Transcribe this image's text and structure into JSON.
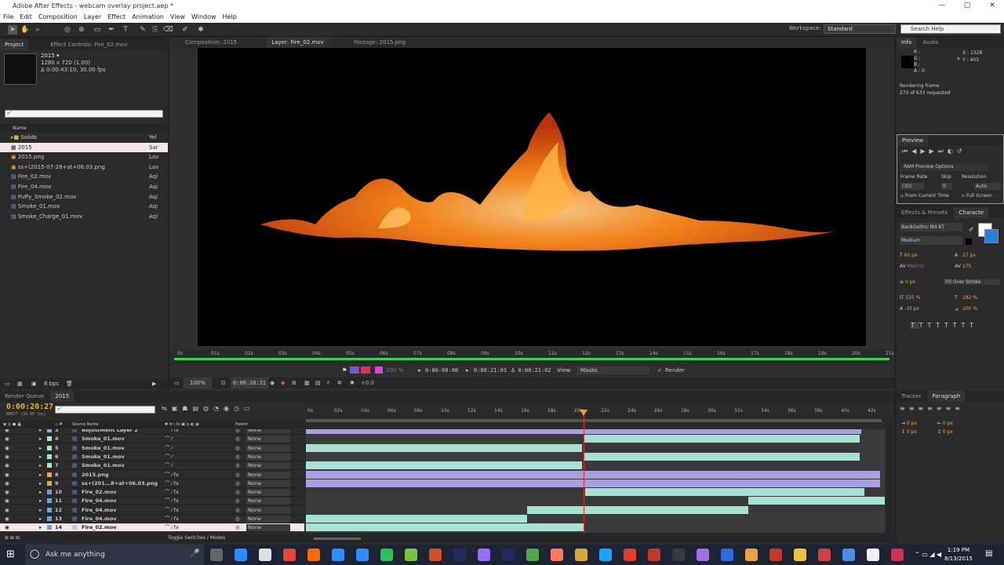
{
  "window": {
    "title": "Adobe After Effects - webcam overlay project.aep *"
  },
  "menu": [
    "File",
    "Edit",
    "Composition",
    "Layer",
    "Effect",
    "Animation",
    "View",
    "Window",
    "Help"
  ],
  "toolbar": {
    "workspace_label": "Workspace:",
    "workspace_value": "Standard",
    "search_placeholder": "Search Help"
  },
  "project": {
    "tabs": [
      "Project",
      "Effect Controls: Fire_02.mov"
    ],
    "selected_name": "2015 ▾",
    "selected_info1": "1280 x 720 (1.00)",
    "selected_info2": "Δ 0:00:43:10, 30.00 fps",
    "search_placeholder": "⌕ᐟ",
    "col_name": "Name",
    "items": [
      {
        "name": "Solids",
        "type": "Yel"
      },
      {
        "name": "2015",
        "type": "Sar"
      },
      {
        "name": "2015.png",
        "type": "Lav"
      },
      {
        "name": "ss+(2015-07-28+at+06.03.png",
        "type": "Lav"
      },
      {
        "name": "Fire_02.mov",
        "type": "Aqi"
      },
      {
        "name": "Fire_04.mov",
        "type": "Aqi"
      },
      {
        "name": "Puffy_Smoke_02.mov",
        "type": "Aqi"
      },
      {
        "name": "Smoke_01.mov",
        "type": "Aqi"
      },
      {
        "name": "Smoke_Charge_01.mov",
        "type": "Aqi"
      }
    ],
    "bpc": "8 bpc"
  },
  "viewer": {
    "tabs": [
      "Composition: 2015",
      "Layer: Fire_02.mov",
      "Footage: 2015.png"
    ],
    "ruler_labels": [
      "0s",
      "01s",
      "02s",
      "03s",
      "04s",
      "05s",
      "06s",
      "07s",
      "08s",
      "09s",
      "10s",
      "11s",
      "12s",
      "13s",
      "14s",
      "15s",
      "16s",
      "17s",
      "18s",
      "19s",
      "20s",
      "21s"
    ],
    "in_time": "0:00:00:00",
    "out_time": "0:00:21:01",
    "duration": "Δ 0:00:21:02",
    "view_label": "View:",
    "view_value": "Masks",
    "render_label": "Render",
    "zoom": "100%",
    "timecode": "0:00:20:21",
    "exposure": "+0.0",
    "percent": "100 %"
  },
  "info": {
    "tabs": [
      "Info",
      "Audio"
    ],
    "r": "R :",
    "g": "G :",
    "b": "B :",
    "a": "A : 0",
    "x": "X : 1328",
    "y": "Y : 403",
    "status1": "Rendering frame",
    "status2": "270 of 633 requested"
  },
  "preview": {
    "tab": "Preview",
    "ram_options": "RAM Preview Options",
    "frame_rate_label": "Frame Rate",
    "skip_label": "Skip",
    "resolution_label": "Resolution",
    "frame_rate": "(30)",
    "skip": "0",
    "resolution": "Auto",
    "from_current": "From Current Time",
    "full_screen": "Full Screen"
  },
  "character": {
    "tabs": [
      "Effects & Presets",
      "Characte"
    ],
    "font": "BankGothic Md BT",
    "style": "Medium",
    "size": "60 px",
    "leading": "27 px",
    "kerning": "Metrics",
    "tracking": "175",
    "stroke": "0 px",
    "stroke_mode": "Fill Over Stroke",
    "vscale": "535 %",
    "hscale": "182 %",
    "baseline": "-33 px",
    "tsume": "100 %"
  },
  "timeline": {
    "tabs": [
      "Render Queue",
      "2015"
    ],
    "timecode": "0:00:20:27",
    "timecode_sub": "00627 (30.00 fps)",
    "search_placeholder": "⌕ᐟ",
    "col_source": "Source Name",
    "col_parent": "Parent",
    "ruler": [
      "0s",
      "02s",
      "04s",
      "06s",
      "08s",
      "10s",
      "12s",
      "14s",
      "16s",
      "18s",
      "20s",
      "22s",
      "24s",
      "26s",
      "28s",
      "30s",
      "32s",
      "34s",
      "36s",
      "38s",
      "40s",
      "42s"
    ],
    "toggle_label": "Toggle Switches / Modes",
    "layers": [
      {
        "num": "3",
        "name": "Adjustment Layer 2",
        "parent": "None",
        "fx": true
      },
      {
        "num": "4",
        "name": "Smoke_01.mov",
        "parent": "None",
        "fx": false
      },
      {
        "num": "5",
        "name": "Smoke_01.mov",
        "parent": "None",
        "fx": false
      },
      {
        "num": "6",
        "name": "Smoke_01.mov",
        "parent": "None",
        "fx": false
      },
      {
        "num": "7",
        "name": "Smoke_01.mov",
        "parent": "None",
        "fx": false
      },
      {
        "num": "8",
        "name": "2015.png",
        "parent": "None",
        "fx": true
      },
      {
        "num": "9",
        "name": "ss+(201...8+at+06.03.png",
        "parent": "None",
        "fx": true
      },
      {
        "num": "10",
        "name": "Fire_02.mov",
        "parent": "None",
        "fx": true
      },
      {
        "num": "11",
        "name": "Fire_04.mov",
        "parent": "None",
        "fx": true
      },
      {
        "num": "12",
        "name": "Fire_04.mov",
        "parent": "None",
        "fx": true
      },
      {
        "num": "13",
        "name": "Fire_04.mov",
        "parent": "None",
        "fx": true
      },
      {
        "num": "14",
        "name": "Fire_02.mov",
        "parent": "None",
        "fx": true
      }
    ]
  },
  "paragraph": {
    "tabs": [
      "Tracker",
      "Paragraph"
    ],
    "indent1": "0 px",
    "indent2": "0 px",
    "indent3": "0 px",
    "indent4": "0 px"
  },
  "taskbar": {
    "search": "Ask me anything",
    "time": "1:19 PM",
    "date": "8/13/2015"
  }
}
